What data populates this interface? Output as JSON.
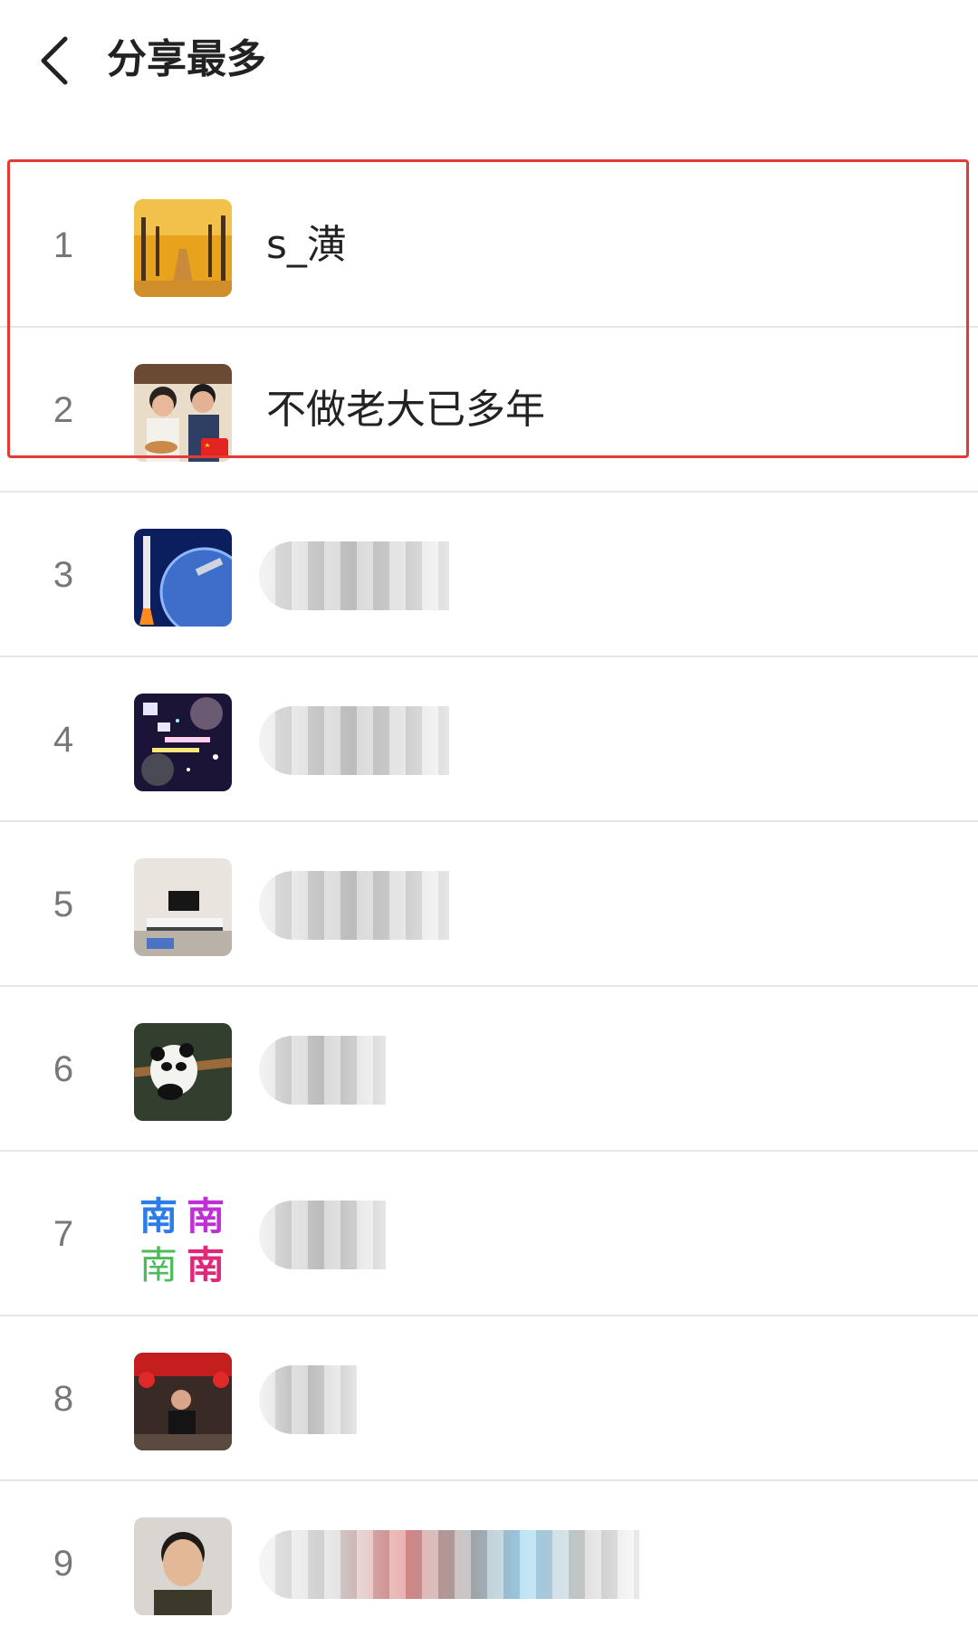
{
  "header": {
    "back_icon": "chevron-left-icon",
    "title": "分享最多"
  },
  "accent_color": "#e53935",
  "rows": [
    {
      "rank": "1",
      "name": "s_潢",
      "avatar": "ginkgo-avenue-photo"
    },
    {
      "rank": "2",
      "name": "不做老大已多年",
      "avatar": "family-photo-with-china-flag"
    },
    {
      "rank": "3",
      "name": "",
      "avatar": "rocket-space-earth-image"
    },
    {
      "rank": "4",
      "name": "",
      "avatar": "night-sky-text-image"
    },
    {
      "rank": "5",
      "name": "",
      "avatar": "living-room-tv-photo"
    },
    {
      "rank": "6",
      "name": "",
      "avatar": "panda-photo"
    },
    {
      "rank": "7",
      "name": "",
      "avatar": "rainbow-nan-characters-image"
    },
    {
      "rank": "8",
      "name": "",
      "avatar": "red-lanterns-man-photo"
    },
    {
      "rank": "9",
      "name": "",
      "avatar": "man-portrait-photo"
    }
  ]
}
